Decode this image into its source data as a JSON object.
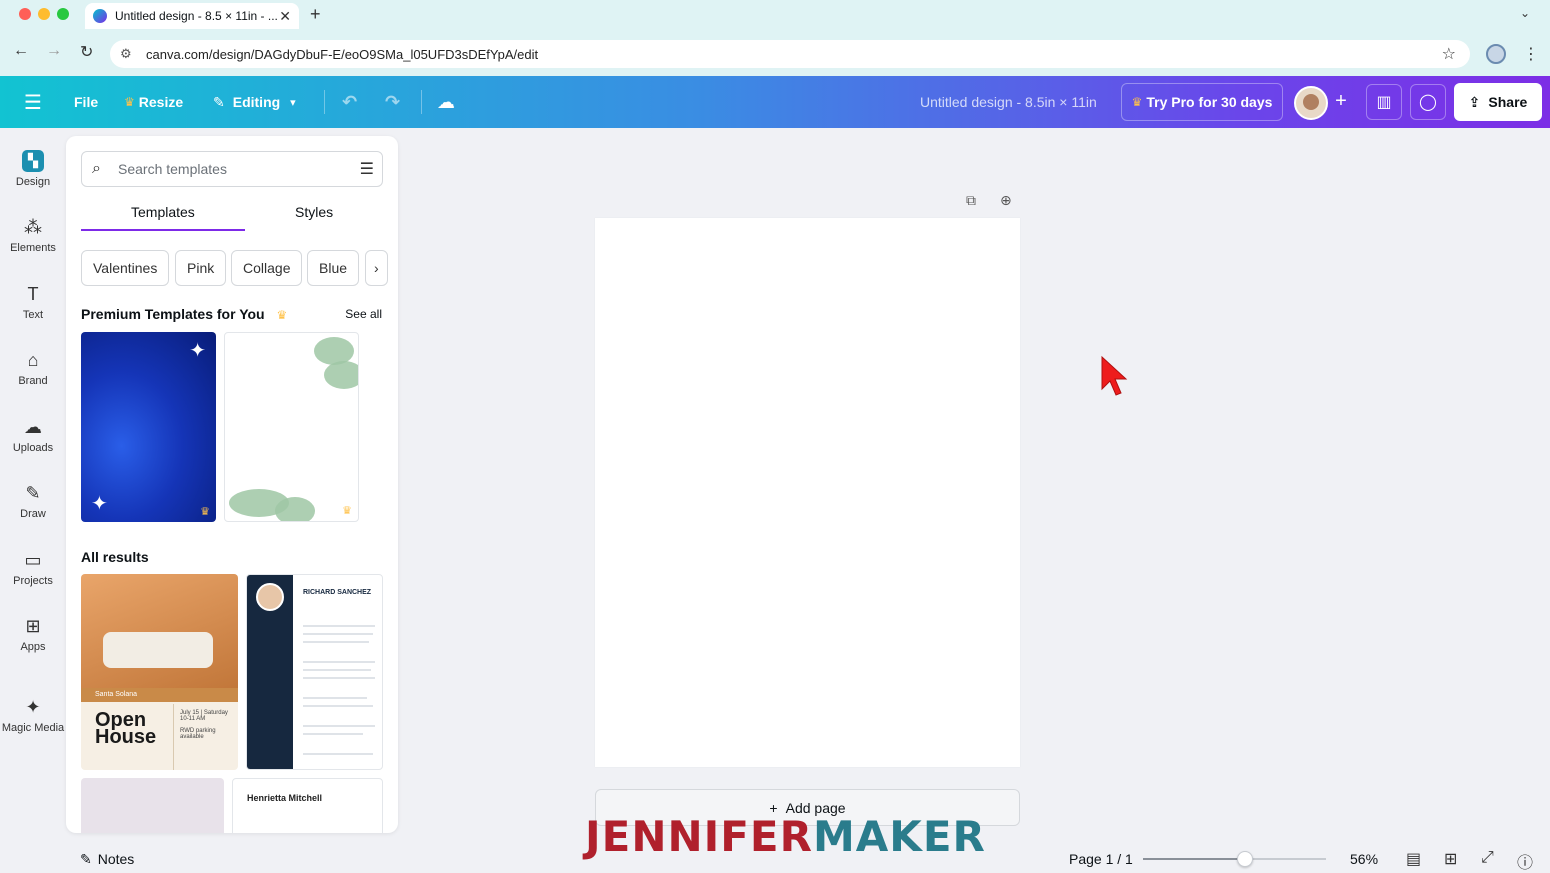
{
  "browser": {
    "tab_title": "Untitled design - 8.5 × 11in - ...",
    "url": "canva.com/design/DAGdyDbuF-E/eoO9SMa_l05UFD3sDEfYpA/edit",
    "traffic_colors": [
      "#ff5f57",
      "#febc2e",
      "#28c840"
    ]
  },
  "toolbar": {
    "file": "File",
    "resize": "Resize",
    "editing": "Editing",
    "title": "Untitled design - 8.5in × 11in",
    "try_pro": "Try Pro for 30 days",
    "share": "Share"
  },
  "rail": {
    "items": [
      {
        "label": "Design",
        "icon": "design-icon"
      },
      {
        "label": "Elements",
        "icon": "elements-icon"
      },
      {
        "label": "Text",
        "icon": "text-icon"
      },
      {
        "label": "Brand",
        "icon": "brand-icon"
      },
      {
        "label": "Uploads",
        "icon": "uploads-icon"
      },
      {
        "label": "Draw",
        "icon": "draw-icon"
      },
      {
        "label": "Projects",
        "icon": "projects-icon"
      },
      {
        "label": "Apps",
        "icon": "apps-icon"
      },
      {
        "label": "Magic Media",
        "icon": "magic-media-icon"
      }
    ]
  },
  "panel": {
    "search_placeholder": "Search templates",
    "tabs": [
      "Templates",
      "Styles"
    ],
    "chips": [
      "Valentines",
      "Pink",
      "Collage",
      "Blue"
    ],
    "premium_heading": "Premium Templates for You",
    "see_all": "See all",
    "all_results": "All results",
    "t3": {
      "bar": "Santa Solana",
      "title_line1": "Open",
      "title_line2": "House",
      "info1": "July 15 | Saturday",
      "info2": "10-11 AM",
      "info3": "RWD parking available"
    },
    "t4": {
      "name": "RICHARD SANCHEZ"
    },
    "t6": {
      "name": "Henrietta Mitchell"
    }
  },
  "canvas": {
    "add_page": "Add page",
    "watermark_part1": "JENNIFER",
    "watermark_part2": "MAKER"
  },
  "footer": {
    "notes": "Notes",
    "page": "Page 1 / 1",
    "zoom": "56%",
    "zoom_level": 0.56
  }
}
